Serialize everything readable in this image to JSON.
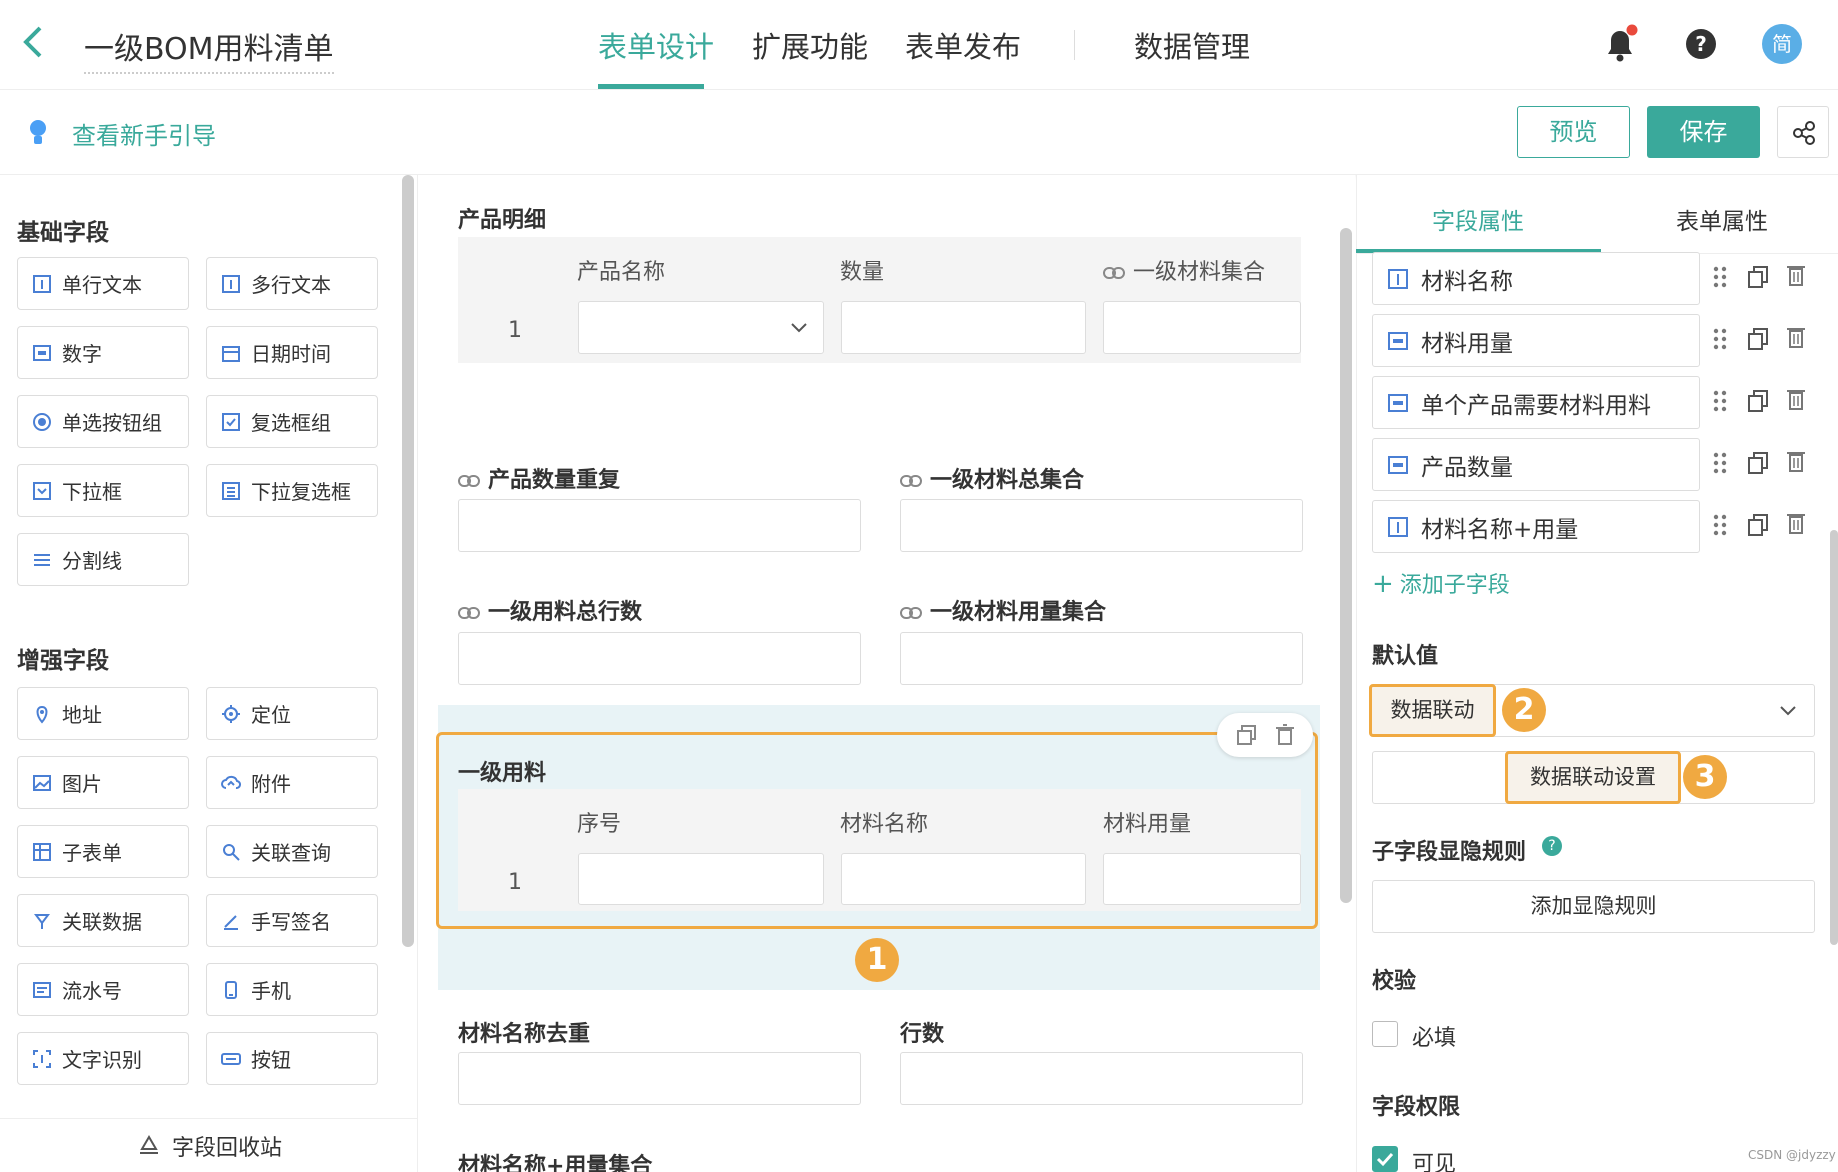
{
  "header": {
    "title": "一级BOM用料清单",
    "tabs": [
      {
        "label": "表单设计",
        "active": true
      },
      {
        "label": "扩展功能"
      },
      {
        "label": "表单发布"
      },
      {
        "label": "数据管理"
      }
    ],
    "avatar_text": "简"
  },
  "subbar": {
    "guide": "查看新手引导",
    "preview": "预览",
    "save": "保存"
  },
  "left": {
    "basic_title": "基础字段",
    "basic": [
      "单行文本",
      "多行文本",
      "数字",
      "日期时间",
      "单选按钮组",
      "复选框组",
      "下拉框",
      "下拉复选框",
      "分割线"
    ],
    "enhanced_title": "增强字段",
    "enhanced": [
      "地址",
      "定位",
      "图片",
      "附件",
      "子表单",
      "关联查询",
      "关联数据",
      "手写签名",
      "流水号",
      "手机",
      "文字识别",
      "按钮"
    ],
    "recycle": "字段回收站"
  },
  "canvas": {
    "product_detail": {
      "label": "产品明细",
      "columns": [
        "产品名称",
        "数量",
        "一级材料集合"
      ],
      "row_no": "1"
    },
    "fields_a": [
      "产品数量重复",
      "一级材料总集合"
    ],
    "fields_b": [
      "一级用料总行数",
      "一级材料用量集合"
    ],
    "level1": {
      "label": "一级用料",
      "columns": [
        "序号",
        "材料名称",
        "材料用量"
      ],
      "row_no": "1"
    },
    "fields_c": [
      "材料名称去重",
      "行数"
    ],
    "fields_d": [
      "材料名称+用量集合"
    ],
    "badge1": "1"
  },
  "right": {
    "tabs": [
      "字段属性",
      "表单属性"
    ],
    "subfields": [
      "材料名称",
      "材料用量",
      "单个产品需要材料用料",
      "产品数量",
      "材料名称+用量"
    ],
    "add_subfield": "添加子字段",
    "default_label": "默认值",
    "default_option": "数据联动",
    "badge2": "2",
    "linkage_btn": "数据联动设置",
    "badge3": "3",
    "visibility_label": "子字段显隐规则",
    "visibility_btn": "添加显隐规则",
    "validate_label": "校验",
    "required": "必填",
    "perm_label": "字段权限",
    "visible": "可见"
  },
  "watermark": "CSDN @jdyzzy",
  "colors": {
    "accent": "#3aa99b",
    "highlight": "#f0a941"
  }
}
